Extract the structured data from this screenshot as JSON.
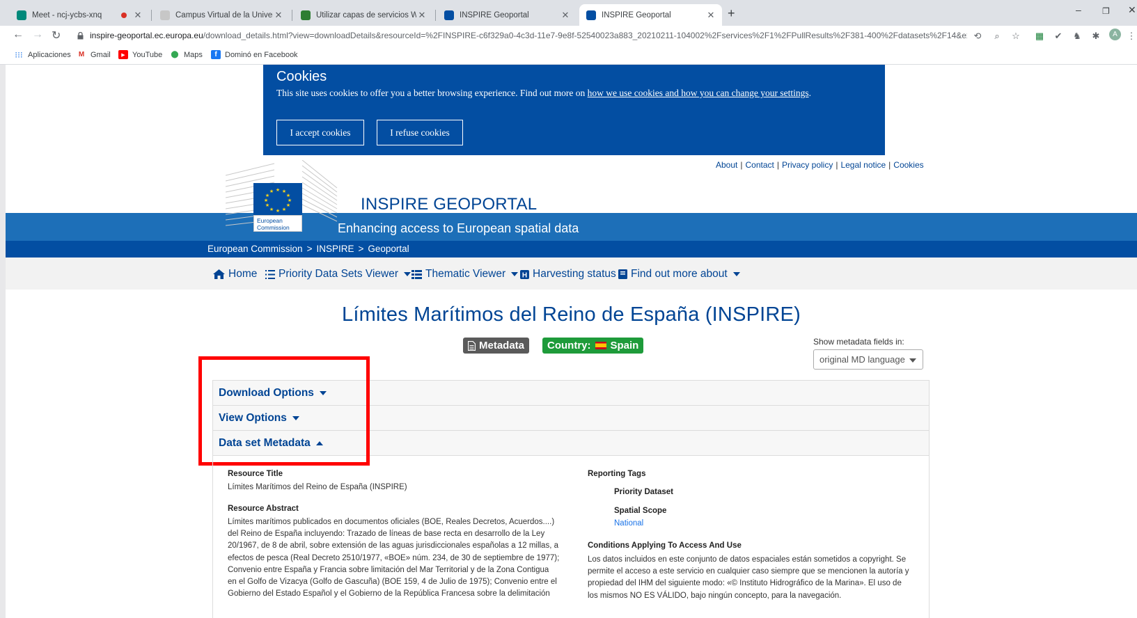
{
  "browser": {
    "tabs": [
      {
        "title": "Meet - ncj-ycbs-xnq",
        "active": false
      },
      {
        "title": "",
        "active": false
      },
      {
        "title": "Campus Virtual de la Universidad",
        "active": false
      },
      {
        "title": "Utilizar capas de servicios WFS—",
        "active": false
      },
      {
        "title": "INSPIRE Geoportal",
        "active": false
      },
      {
        "title": "INSPIRE Geoportal",
        "active": true
      }
    ],
    "url_host": "inspire-geoportal.ec.europa.eu",
    "url_path": "/download_details.html?view=downloadDetails&resourceId=%2FINSPIRE-c6f329a0-4c3d-11e7-9e8f-52540023a883_20210211-104002%2Fservices%2F1%2FPullResults%2F381-400%2Fdatasets%2F14&expan...",
    "avatar_letter": "A",
    "bookmarks": [
      "Aplicaciones",
      "Gmail",
      "YouTube",
      "Maps",
      "Dominó en Facebook"
    ]
  },
  "cookie": {
    "title": "Cookies",
    "text": "This site uses cookies to offer you a better browsing experience. Find out more on ",
    "link": "how we use cookies and how you can change your settings",
    "text_end": ".",
    "accept": "I accept cookies",
    "refuse": "I refuse cookies"
  },
  "toplinks": [
    "About",
    "Contact",
    "Privacy policy",
    "Legal notice",
    "Cookies"
  ],
  "logo": {
    "line1": "European",
    "line2": "Commission"
  },
  "header": {
    "title": "INSPIRE GEOPORTAL",
    "subtitle": "Enhancing access to European spatial data"
  },
  "breadcrumb": [
    "European Commission",
    "INSPIRE",
    "Geoportal"
  ],
  "menu": [
    "Home",
    "Priority Data Sets Viewer",
    "Thematic Viewer",
    "Harvesting status",
    "Find out more about"
  ],
  "dataset": {
    "title": "Límites Marítimos del Reino de España (INSPIRE)",
    "metadata_badge": "Metadata",
    "country_label": "Country:",
    "country": "Spain",
    "show_fields_label": "Show metadata fields in:",
    "language_select": "original MD language"
  },
  "accordion": [
    "Download Options",
    "View Options",
    "Data set Metadata"
  ],
  "metadata": {
    "resource_title_h": "Resource Title",
    "resource_title": "Límites Marítimos del Reino de España (INSPIRE)",
    "abstract_h": "Resource Abstract",
    "abstract_lines": [
      "Límites marítimos publicados en documentos oficiales (BOE, Reales Decretos, Acuerdos....)",
      "del Reino de España incluyendo: Trazado de líneas de base recta en desarrollo de la Ley",
      "20/1967, de 8 de abril, sobre extensión de las aguas jurisdiccionales españolas a 12 millas, a",
      "efectos de pesca (Real Decreto 2510/1977, «BOE» núm. 234, de 30 de septiembre de 1977);",
      "Convenio entre España y Francia sobre limitación del Mar Territorial y de la Zona Contigua",
      "en el Golfo de Vizacya (Golfo de Gascuña) (BOE 159, 4 de Julio de 1975); Convenio entre el",
      "Gobierno del Estado Español y el Gobierno de la República Francesa sobre la delimitación"
    ],
    "reporting_tags_h": "Reporting Tags",
    "priority_dataset_h": "Priority Dataset",
    "spatial_scope_h": "Spatial Scope",
    "spatial_scope": "National",
    "conditions_h": "Conditions Applying To Access And Use",
    "conditions_lines": [
      "Los datos incluidos en este conjunto de datos espaciales están sometidos a copyright. Se",
      "permite el acceso a este servicio en cualquier caso siempre que se mencionen la autoría y",
      "propiedad del IHM del siguiente modo: «© Instituto Hidrográfico de la Marina». El uso de",
      "los mismos NO ES VÁLIDO, bajo ningún concepto, para la navegación."
    ]
  },
  "colors": {
    "ec_blue": "#034ea2",
    "link_blue": "#004494",
    "band_blue": "#1d6fb8",
    "highlight": "#ff0000",
    "country_green": "#1e9b3a"
  }
}
